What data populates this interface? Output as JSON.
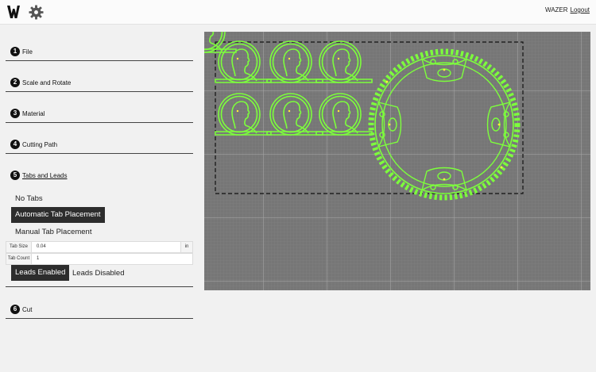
{
  "header": {
    "brand": "WAZER",
    "logout": "Logout"
  },
  "steps": [
    {
      "number": "1",
      "label": "File"
    },
    {
      "number": "2",
      "label": "Scale and Rotate"
    },
    {
      "number": "3",
      "label": "Material"
    },
    {
      "number": "4",
      "label": "Cutting Path"
    },
    {
      "number": "5",
      "label": "Tabs and Leads"
    },
    {
      "number": "6",
      "label": "Cut"
    }
  ],
  "tabs": {
    "no_tabs": "No Tabs",
    "automatic": "Automatic Tab Placement",
    "manual": "Manual Tab Placement",
    "tab_size_label": "Tab Size",
    "tab_size_value": "0.04",
    "tab_size_unit": "in",
    "tab_count_label": "Tab Count",
    "tab_count_value": "1",
    "leads_enabled": "Leads Enabled",
    "leads_disabled": "Leads Disabled"
  },
  "colors": {
    "cut_path": "#7dff3c",
    "canvas": "#777777",
    "selected": "#2d2d2d"
  },
  "icons": {
    "logo": "wazer-logo",
    "settings": "gear-icon"
  }
}
